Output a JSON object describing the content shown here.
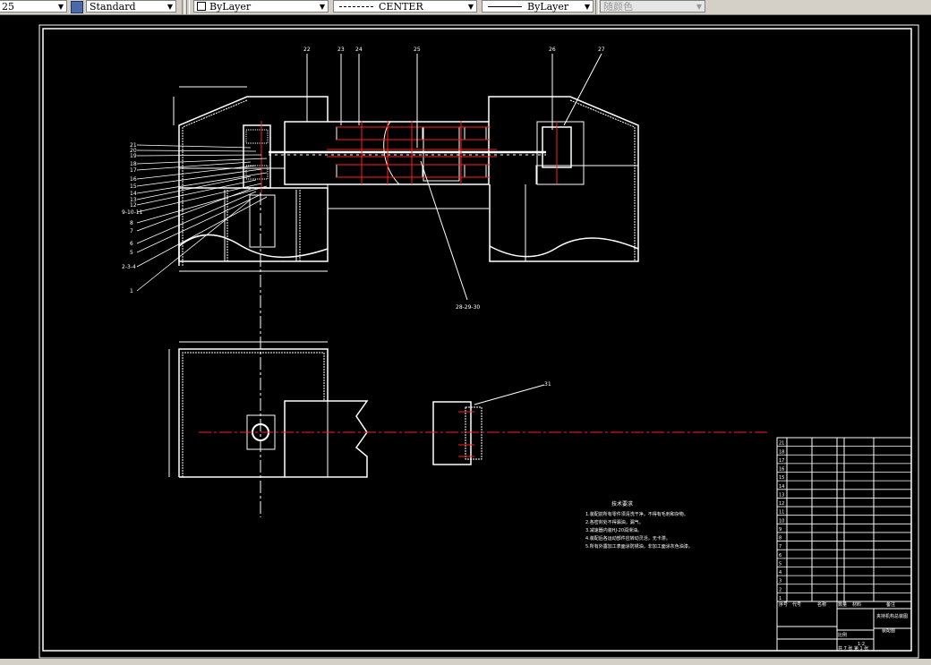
{
  "toolbar": {
    "text_height": "25",
    "text_style": "Standard",
    "layer_color": "ByLayer",
    "linetype": "CENTER",
    "lineweight": "ByLayer",
    "plot_style": "随颜色"
  },
  "colors": {
    "background": "#000000",
    "lines": "#ffffff",
    "center_lines": "#ff2020",
    "toolbar": "#d4d0c8"
  },
  "balloons_top": [
    "22",
    "23",
    "24",
    "25",
    "26",
    "27"
  ],
  "balloons_left": [
    "21",
    "20",
    "19",
    "18",
    "17",
    "16",
    "15",
    "14",
    "13",
    "12",
    "9-10-11",
    "8",
    "7",
    "6",
    "5",
    "2-3-4",
    "1"
  ],
  "balloon_section": "28-29-30",
  "balloon_lower": "31",
  "tech_requirements": {
    "heading": "技术要求",
    "items": [
      "1.装配前所有零件须清洗干净，不得有毛刺和杂物。",
      "2.各密封处不得漏油，漏气。",
      "3.减速器内装HJ-20润滑油。",
      "4.装配后各运动部件应转动灵活，无卡滞。",
      "5.所有外露加工表面涂防锈油，非加工面涂灰色油漆。"
    ]
  },
  "parts_list": {
    "row_numbers": [
      "21",
      "18",
      "17",
      "16",
      "15",
      "14",
      "13",
      "12",
      "11",
      "10",
      "9",
      "8",
      "7",
      "6",
      "5",
      "4",
      "3",
      "2",
      "1"
    ],
    "header": [
      "序号",
      "代号",
      "名称",
      "数量",
      "材料",
      "备注"
    ]
  },
  "title_block": {
    "drawing_name": "夹持机构总装图",
    "school": "装配图",
    "scale_label": "比例",
    "scale": "1:2",
    "sheet": "共 7 张 第 1 张"
  }
}
